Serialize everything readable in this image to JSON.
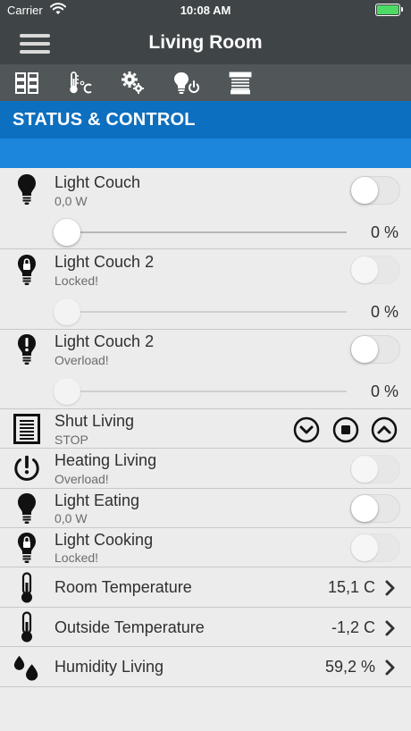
{
  "status_bar": {
    "carrier": "Carrier",
    "time": "10:08 AM",
    "battery_color": "#4cd964"
  },
  "nav": {
    "title": "Living Room",
    "menu_icon": "hamburger-icon"
  },
  "tabs": [
    {
      "name": "grid-icon"
    },
    {
      "name": "thermometer-celsius-icon"
    },
    {
      "name": "gears-icon"
    },
    {
      "name": "bulb-power-icon"
    },
    {
      "name": "blinds-icon"
    }
  ],
  "section": {
    "title": "STATUS & CONTROL",
    "color": "#0d6fbf",
    "band_color": "#1c85dc"
  },
  "rows": {
    "light_couch": {
      "title": "Light Couch",
      "subtitle": "0,0 W",
      "toggle_on": false,
      "level": "0 %"
    },
    "light_couch2_locked": {
      "title": "Light Couch 2",
      "subtitle": "Locked!",
      "toggle_on": false,
      "level": "0 %"
    },
    "light_couch2_overload": {
      "title": "Light Couch 2",
      "subtitle": "Overload!",
      "toggle_on": false,
      "level": "0 %"
    },
    "shut_living": {
      "title": "Shut Living",
      "subtitle": "STOP"
    },
    "heating_living": {
      "title": "Heating Living",
      "subtitle": "Overload!",
      "toggle_on": false
    },
    "light_eating": {
      "title": "Light Eating",
      "subtitle": "0,0 W",
      "toggle_on": false
    },
    "light_cooking": {
      "title": "Light Cooking",
      "subtitle": "Locked!",
      "toggle_on": false
    },
    "room_temp": {
      "title": "Room Temperature",
      "value": "15,1 C"
    },
    "outside_temp": {
      "title": "Outside Temperature",
      "value": "-1,2 C"
    },
    "humidity": {
      "title": "Humidity Living",
      "value": "59,2 %"
    }
  }
}
